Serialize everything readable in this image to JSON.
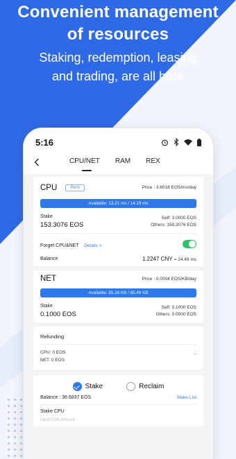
{
  "hero": {
    "title_line1": "Convenient management",
    "title_line2": "of resources",
    "subtitle_line1": "Staking, redemption, leasing",
    "subtitle_line2": "and trading, are all here"
  },
  "status": {
    "time": "5:16"
  },
  "tabs": [
    "CPU/NET",
    "RAM",
    "REX"
  ],
  "cpu": {
    "title": "CPU",
    "rent_label": "Rent",
    "price": "Price : 3.6018 EOS/ms/day",
    "available": "Available: 13.21 ms / 14.19 ms",
    "stake_label": "Stake",
    "stake_value": "153.3076 EOS",
    "self": "Self: 3.0000 EOS",
    "others": "Others: 150.3076 EOS",
    "forget_label": "Forget CPU&NET",
    "details_label": "Details >",
    "balance_label": "Balance",
    "balance_value": "1.2247 CNY",
    "balance_ms": "= 24.49 ms"
  },
  "net": {
    "title": "NET",
    "price": "Price : 0.0004 EOS/KB/day",
    "available": "Available: 85.28 KB / 85.49 KB",
    "stake_label": "Stake",
    "stake_value": "0.1000 EOS",
    "self": "Self: 0.1000 EOS",
    "others": "Others: 0.0000 EOS"
  },
  "refunding": {
    "title": "Refunding",
    "cpu": "CPU: 0 EOS",
    "net": "NET: 0 EOS",
    "tilde": "~"
  },
  "stake_panel": {
    "stake_option": "Stake",
    "reclaim_option": "Reclaim",
    "balance": "Balance : 36.6837 EOS",
    "stake_list": "Stake List",
    "stake_cpu_label": "Stake CPU",
    "input_placeholder": "Input EOS Amount"
  },
  "colors": {
    "brand_blue": "#2f6ae6",
    "accent": "#2f78e8",
    "toggle_on": "#2fc26a"
  }
}
